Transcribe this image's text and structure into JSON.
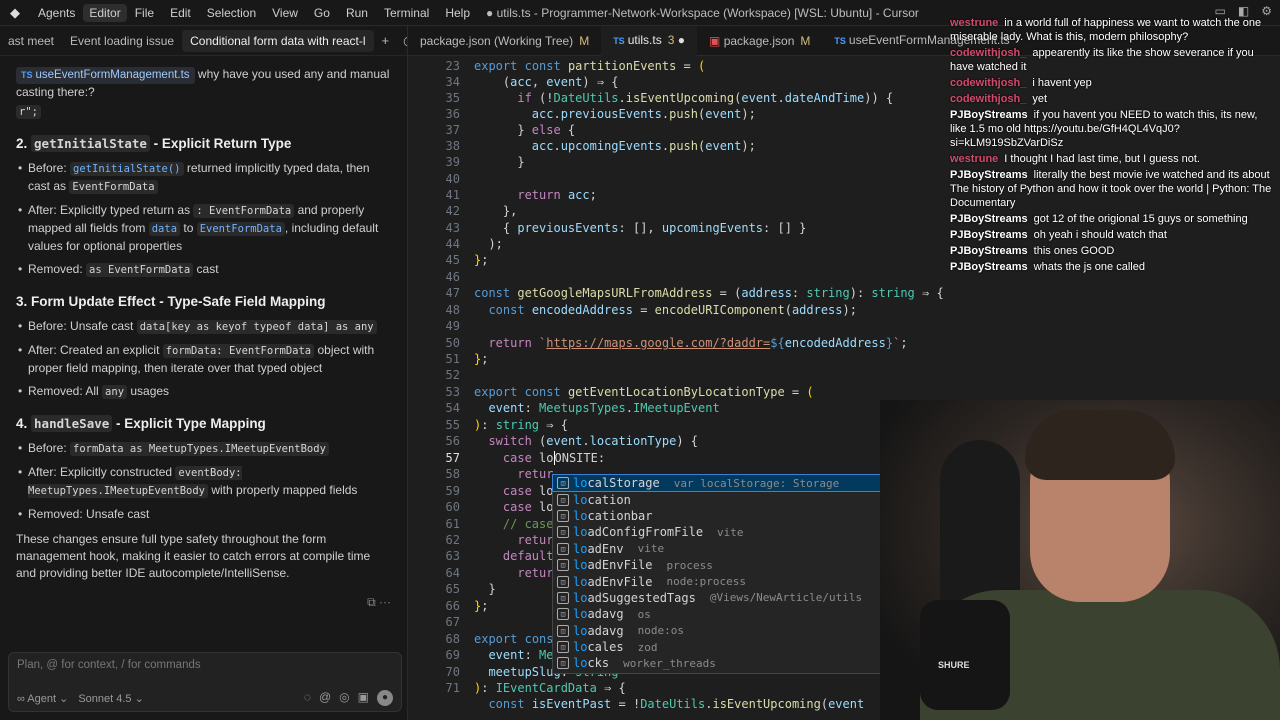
{
  "titlebar": {
    "items": [
      "Agents",
      "Editor",
      "File",
      "Edit",
      "Selection",
      "View",
      "Go",
      "Run",
      "Terminal",
      "Help"
    ],
    "title": "● utils.ts - Programmer-Network-Workspace (Workspace) [WSL: Ubuntu] - Cursor"
  },
  "left": {
    "tabs": [
      "ast meet",
      "Event loading issue",
      "Conditional form data with react-l"
    ],
    "file_chip": "useEventFormManagement.ts",
    "question": "why have you used any and manual casting there:?",
    "stray": "r\";",
    "s2": {
      "num": "2.",
      "code": "getInitialState",
      "rest": " - Explicit Return Type",
      "b1_label": "Before",
      "b1_pre": ": ",
      "b1_code": "getInitialState()",
      "b1_mid": " returned implicitly typed data, then cast as ",
      "b1_code2": "EventFormData",
      "b2_label": "After",
      "b2_pre": ": Explicitly typed return as ",
      "b2_code": ": EventFormData",
      "b2_mid": " and properly mapped all fields from ",
      "b2_code2": "data",
      "b2_mid2": " to ",
      "b2_code3": "EventFormData",
      "b2_end": ", including default values for optional properties",
      "b3_label": "Removed",
      "b3_pre": ": ",
      "b3_code": "as EventFormData",
      "b3_end": " cast"
    },
    "s3": {
      "title": "3. Form Update Effect - Type-Safe Field Mapping",
      "b1_label": "Before",
      "b1_pre": ": Unsafe cast ",
      "b1_code": "data[key as keyof typeof data] as any",
      "b2_label": "After",
      "b2_pre": ": Created an explicit ",
      "b2_code": "formData: EventFormData",
      "b2_end": " object with proper field mapping, then iterate over that typed object",
      "b3_label": "Removed",
      "b3_pre": ": All ",
      "b3_code": "any",
      "b3_end": " usages"
    },
    "s4": {
      "num": "4.",
      "code": "handleSave",
      "rest": " - Explicit Type Mapping",
      "b1_label": "Before",
      "b1_pre": ": ",
      "b1_code": "formData as MeetupTypes.IMeetupEventBody",
      "b2_label": "After",
      "b2_pre": ": Explicitly constructed ",
      "b2_code": "eventBody: MeetupTypes.IMeetupEventBody",
      "b2_end": " with properly mapped fields",
      "b3_label": "Removed",
      "b3_pre": ": Unsafe cast"
    },
    "summary": "These changes ensure full type safety throughout the form management hook, making it easier to catch errors at compile time and providing better IDE autocomplete/IntelliSense.",
    "composer": {
      "placeholder": "Plan, @ for context, / for commands",
      "mode": "Agent",
      "model": "Sonnet 4.5"
    }
  },
  "editor": {
    "tabs": [
      {
        "name": "package.json (Working Tree)",
        "mod": "M"
      },
      {
        "name": "utils.ts",
        "mod": "3"
      },
      {
        "name": "package.json",
        "mod": "M"
      },
      {
        "name": "useEventFormManagement.ts",
        "mod": ""
      }
    ],
    "line_numbers": [
      "23",
      "34",
      "35",
      "36",
      "37",
      "38",
      "39",
      "40",
      "41",
      "42",
      "43",
      "44",
      "45",
      "46",
      "47",
      "48",
      "49",
      "50",
      "51",
      "52",
      "53",
      "54",
      "55",
      "56",
      "57",
      "58",
      "59",
      "60",
      "61",
      "62",
      "63",
      "64",
      "65",
      "66",
      "67",
      "68",
      "69",
      "70",
      "71"
    ],
    "current_line": "56",
    "suggestions": [
      {
        "label": "localStorage",
        "hl": "lo",
        "detail": "var localStorage: Storage"
      },
      {
        "label": "location",
        "hl": "lo",
        "detail": ""
      },
      {
        "label": "locationbar",
        "hl": "lo",
        "detail": ""
      },
      {
        "label": "loadConfigFromFile",
        "hl": "lo",
        "detail": "vite"
      },
      {
        "label": "loadEnv",
        "hl": "lo",
        "detail": "vite"
      },
      {
        "label": "loadEnvFile",
        "hl": "lo",
        "detail": "process"
      },
      {
        "label": "loadEnvFile",
        "hl": "lo",
        "detail": "node:process"
      },
      {
        "label": "loadSuggestedTags",
        "hl": "lo",
        "detail": "@Views/NewArticle/utils"
      },
      {
        "label": "loadavg",
        "hl": "lo",
        "detail": "os"
      },
      {
        "label": "loadavg",
        "hl": "lo",
        "detail": "node:os"
      },
      {
        "label": "locales",
        "hl": "lo",
        "detail": "zod"
      },
      {
        "label": "locks",
        "hl": "lo",
        "detail": "worker_threads"
      }
    ]
  },
  "stream_chat": [
    {
      "user": "westrune",
      "text": "in a world full of happiness we want to watch the one miserable lady. What is this, modern philosophy?"
    },
    {
      "user": "codewithjosh_",
      "text": "appearently its like the show severance if you have watched it"
    },
    {
      "user": "codewithjosh_",
      "text": "i havent yep"
    },
    {
      "user": "codewithjosh_",
      "text": "yet"
    },
    {
      "user": "PJBoyStreams",
      "text": "if you havent you NEED to watch this, its new, like 1.5 mo old https://youtu.be/GfH4QL4VqJ0?si=kLM919SbZVarDiSz"
    },
    {
      "user": "westrune",
      "text": "I thought I had last time, but I guess not."
    },
    {
      "user": "PJBoyStreams",
      "text": "literally the best movie ive watched and its about The history of Python and how it took over the world | Python: The Documentary"
    },
    {
      "user": "PJBoyStreams",
      "text": "got 12 of the origional 15 guys or something"
    },
    {
      "user": "PJBoyStreams",
      "text": "oh yeah i should watch that"
    },
    {
      "user": "PJBoyStreams",
      "text": "this ones GOOD"
    },
    {
      "user": "PJBoyStreams",
      "text": "whats the js one called"
    }
  ],
  "cam": {
    "mic_brand": "SHURE"
  },
  "colors": {
    "accent": "#3d7fd6",
    "chat_red": "#d24a6b"
  }
}
